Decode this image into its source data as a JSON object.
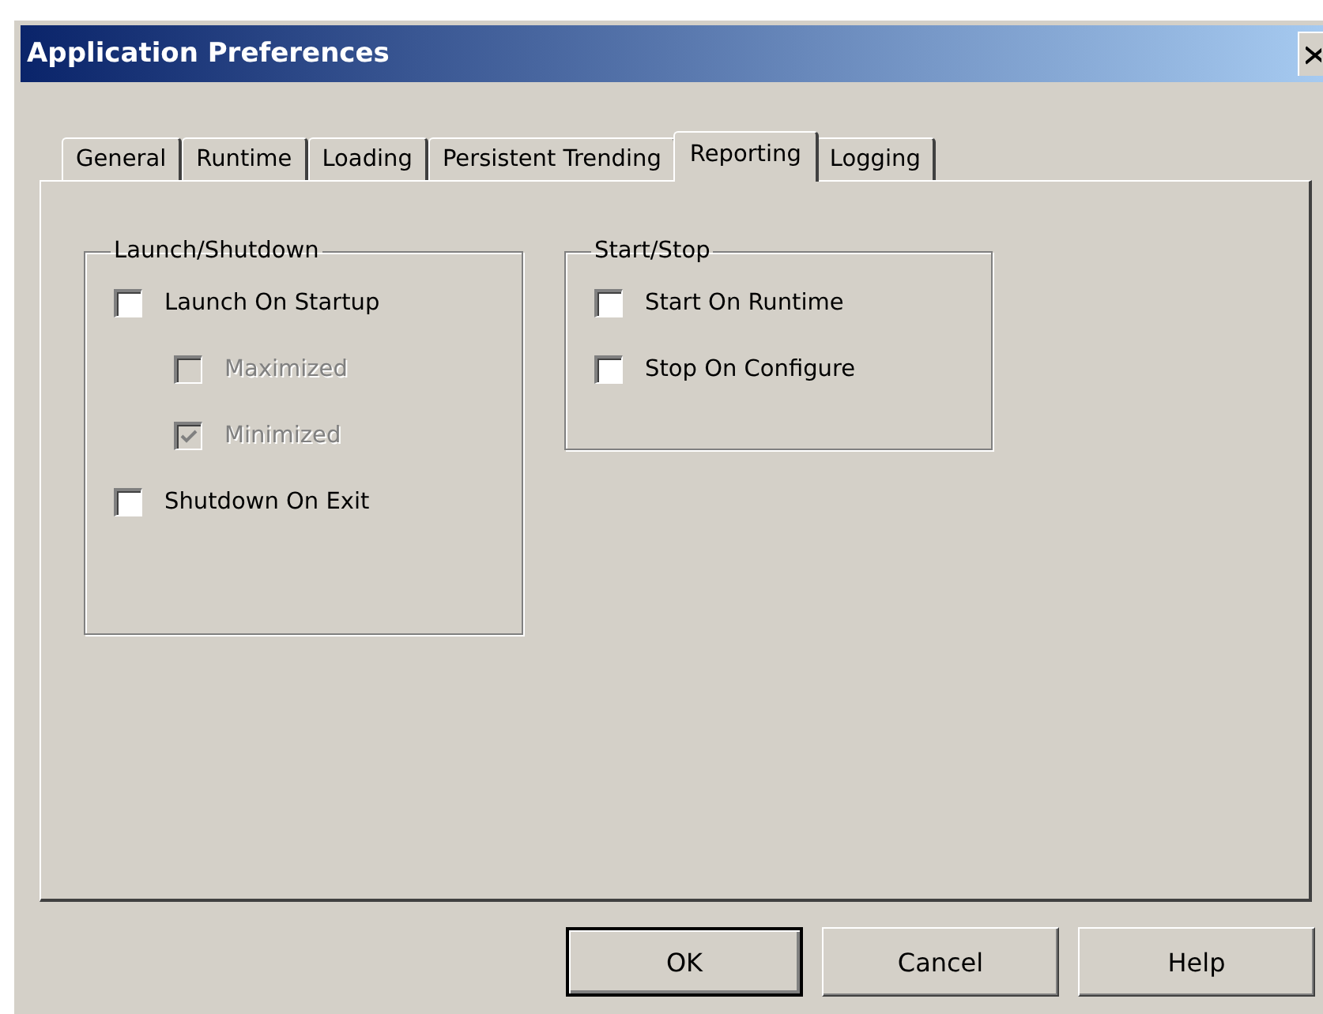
{
  "window": {
    "title": "Application Preferences"
  },
  "tabs": [
    {
      "label": "General",
      "selected": false
    },
    {
      "label": "Runtime",
      "selected": false
    },
    {
      "label": "Loading",
      "selected": false
    },
    {
      "label": "Persistent Trending",
      "selected": false
    },
    {
      "label": "Reporting",
      "selected": true
    },
    {
      "label": "Logging",
      "selected": false
    }
  ],
  "groups": [
    {
      "title": "Launch/Shutdown",
      "options": [
        {
          "label": "Launch On Startup",
          "checked": false,
          "disabled": false,
          "children": [
            {
              "label": "Maximized",
              "checked": false,
              "disabled": true
            },
            {
              "label": "Minimized",
              "checked": true,
              "disabled": true
            }
          ]
        },
        {
          "label": "Shutdown On Exit",
          "checked": false,
          "disabled": false
        }
      ]
    },
    {
      "title": "Start/Stop",
      "options": [
        {
          "label": "Start On Runtime",
          "checked": false,
          "disabled": false
        },
        {
          "label": "Stop On Configure",
          "checked": false,
          "disabled": false
        }
      ]
    }
  ],
  "buttons": [
    {
      "label": "OK",
      "default": true
    },
    {
      "label": "Cancel",
      "default": false
    },
    {
      "label": "Help",
      "default": false
    }
  ]
}
